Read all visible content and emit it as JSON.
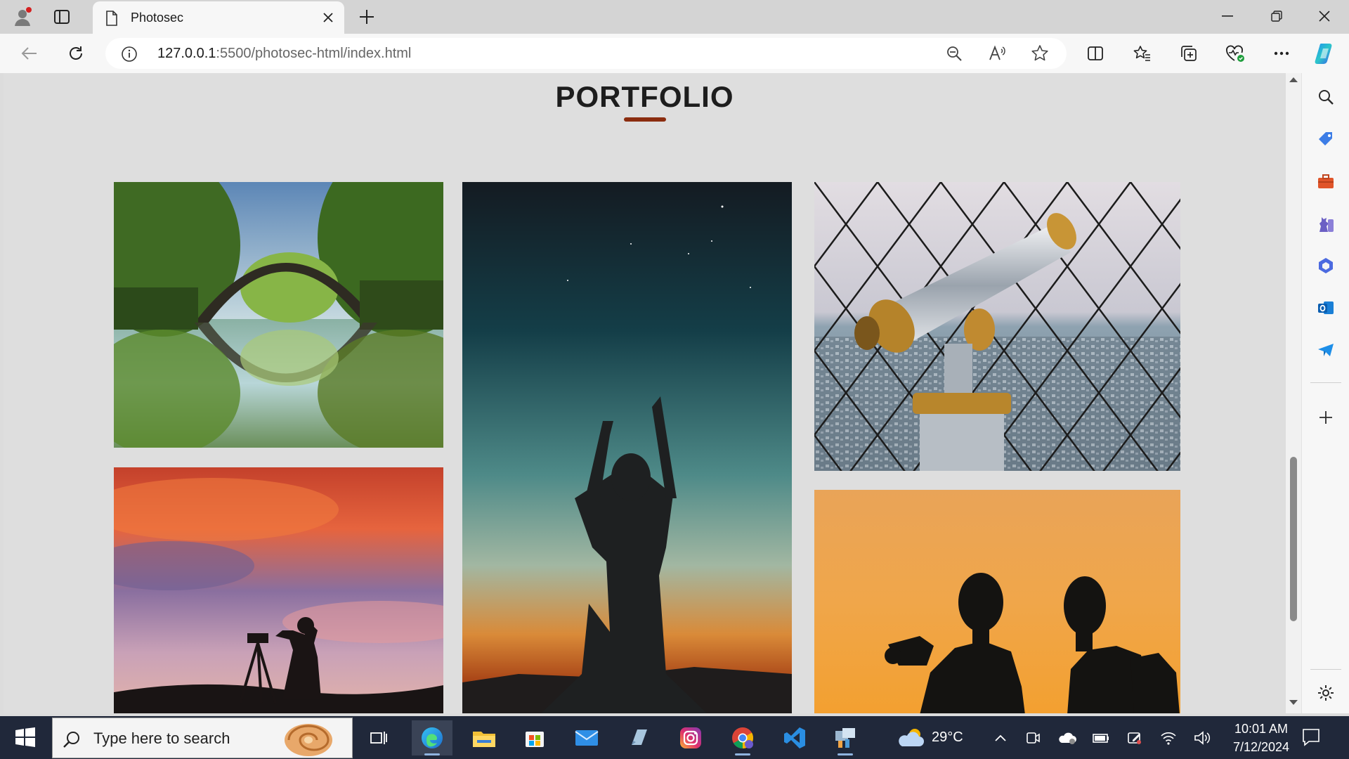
{
  "browser": {
    "tab_title": "Photosec",
    "address": {
      "host": "127.0.0.1",
      "path": ":5500/photosec-html/index.html"
    }
  },
  "page": {
    "section_title": "PORTFOLIO",
    "accent_color": "#8b2d0f",
    "photos": [
      {
        "name": "photo-stone-arch-bridge",
        "subject": "stone arch bridge reflected in lake"
      },
      {
        "name": "photo-crescent-moon-silhouette",
        "subject": "silhouette reaching toward crescent moon"
      },
      {
        "name": "photo-coin-binoculars",
        "subject": "coin-operated binoculars over city"
      },
      {
        "name": "photo-sunset-photographer",
        "subject": "photographer with tripod at sunset"
      },
      {
        "name": "photo-two-photographers",
        "subject": "two photographers silhouetted on orange sky"
      }
    ]
  },
  "scrollbar": {
    "position_fraction": 0.7
  },
  "taskbar": {
    "search_placeholder": "Type here to search",
    "weather_temp": "29°C",
    "time": "10:01 AM",
    "date": "7/12/2024"
  }
}
